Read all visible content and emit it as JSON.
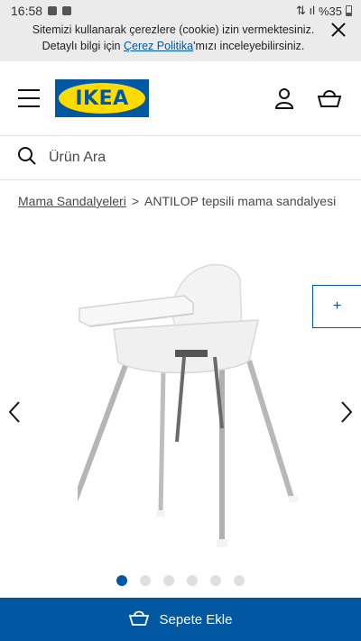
{
  "status_bar": {
    "time": "16:58",
    "battery": "%35"
  },
  "cookie_banner": {
    "text_before_link": "Sitemizi kullanarak çerezlere (cookie) izin vermektesiniz. Detaylı bilgi için ",
    "link_text": "Çerez Politika",
    "text_after_link": "'mızı inceleyebilirsiniz."
  },
  "header": {
    "logo_text": "IKEA",
    "icons": [
      "hamburger-menu-icon",
      "user-icon",
      "shopping-bag-icon"
    ]
  },
  "search": {
    "placeholder": "Ürün Ara",
    "icon": "search-icon"
  },
  "breadcrumb": {
    "parent": "Mama Sandalyeleri",
    "separator": ">",
    "current": "ANTILOP tepsili mama sandalyesi"
  },
  "gallery": {
    "zoom_label": "+",
    "image_count": 6,
    "active_index": 0
  },
  "cart_button": {
    "label": "Sepete Ekle",
    "icon": "cart-icon"
  },
  "colors": {
    "brand_blue": "#0058a3",
    "brand_yellow": "#ffdb00",
    "banner_bg": "#ebebeb"
  }
}
